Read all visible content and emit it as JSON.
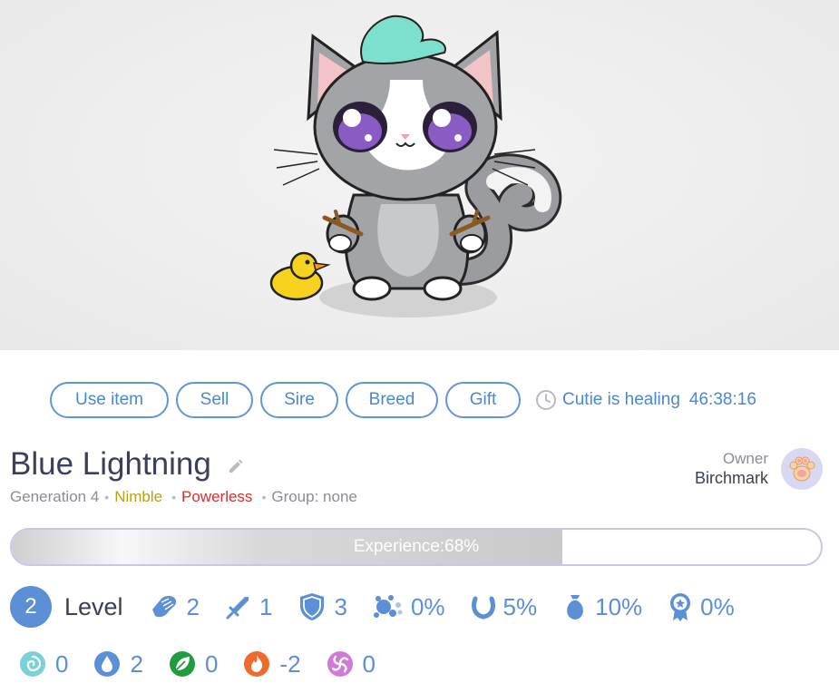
{
  "actions": {
    "use_item": "Use item",
    "sell": "Sell",
    "sire": "Sire",
    "breed": "Breed",
    "gift": "Gift"
  },
  "status": {
    "text": "Cutie is healing",
    "timer": "46:38:16",
    "icon": "clock-icon"
  },
  "cutie": {
    "name": "Blue Lightning",
    "generation": "Generation 4",
    "trait_speed": "Nimble",
    "trait_power": "Powerless",
    "group": "Group: none"
  },
  "owner": {
    "label": "Owner",
    "name": "Birchmark"
  },
  "experience": {
    "label": "Experience:68%",
    "percent": 68
  },
  "level": {
    "value": "2",
    "label": "Level"
  },
  "stats": [
    {
      "icon": "fist-icon",
      "value": "2"
    },
    {
      "icon": "sword-icon",
      "value": "1"
    },
    {
      "icon": "shield-icon",
      "value": "3"
    },
    {
      "icon": "splash-icon",
      "value": "0%"
    },
    {
      "icon": "horseshoe-icon",
      "value": "5%"
    },
    {
      "icon": "money-bag-icon",
      "value": "10%"
    },
    {
      "icon": "medal-icon",
      "value": "0%"
    }
  ],
  "elements": [
    {
      "icon": "air-icon",
      "value": "0",
      "color": "#7ad2d8"
    },
    {
      "icon": "water-icon",
      "value": "2",
      "color": "#5b8fd6"
    },
    {
      "icon": "nature-icon",
      "value": "0",
      "color": "#1f9d3e"
    },
    {
      "icon": "fire-icon",
      "value": "-2",
      "color": "#ef6a2c"
    },
    {
      "icon": "magic-icon",
      "value": "0",
      "color": "#d07ad8"
    }
  ]
}
